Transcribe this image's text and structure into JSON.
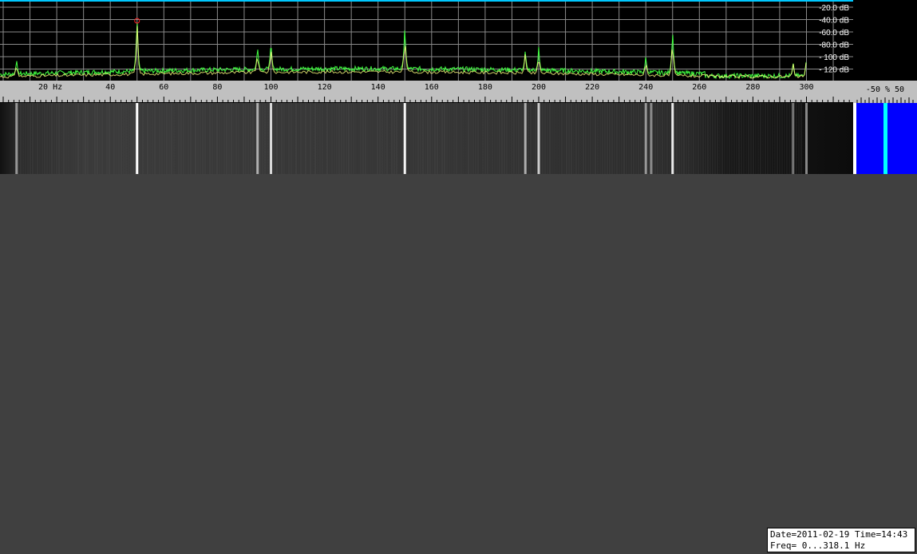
{
  "spectrum": {
    "db_labels": [
      "-20.0 dB",
      "-40.0 dB",
      "-60.0 dB",
      "-80.0 dB",
      "- 100 dB",
      "- 120 dB"
    ],
    "db_values": [
      -20,
      -40,
      -60,
      -80,
      -100,
      -120
    ],
    "peak_marker_hz": 50,
    "peaks_hz": [
      5,
      50,
      95,
      100,
      150,
      195,
      200,
      240,
      250,
      295,
      300
    ],
    "colors": {
      "background": "#000000",
      "grid": "#8a8a8a",
      "top_line": "#00c8ff",
      "trace_green": "#40ff40",
      "trace_yellow": "#ffff80",
      "marker": "#ff2020"
    }
  },
  "frequency_scale": {
    "range_hz": [
      0,
      318.1
    ],
    "labels": [
      "20 Hz",
      "40",
      "60",
      "80",
      "100",
      "120",
      "140",
      "160",
      "180",
      "200",
      "220",
      "240",
      "260",
      "280",
      "300"
    ],
    "label_values": [
      20,
      40,
      60,
      80,
      100,
      120,
      140,
      160,
      180,
      200,
      220,
      240,
      260,
      280,
      300
    ]
  },
  "level_scale": {
    "label": "-50 % 50"
  },
  "level_bar": {
    "colors": {
      "background": "#ffffff",
      "fill": "#0000ff",
      "indicator": "#00ffff"
    }
  },
  "status": {
    "line1": "Date=2011-02-19 Time=14:43",
    "line2": "Freq= 0...318.1 Hz"
  }
}
